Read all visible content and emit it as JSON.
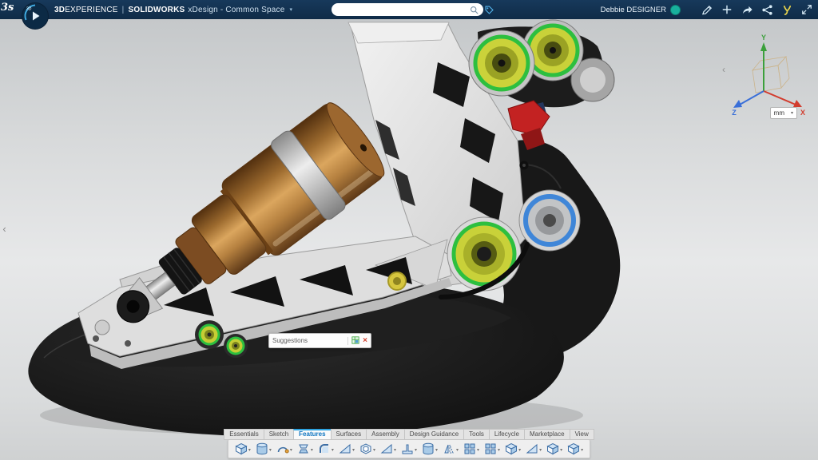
{
  "colors": {
    "topbar": "#12334f",
    "accent": "#2ea3e0",
    "active_tab_text": "#0d74c0",
    "selection_green": "#2dbf3f",
    "shock_bronze": "#b5803f",
    "bearing_blue": "#3f86d8"
  },
  "logo": {
    "monogram": "3s",
    "compass_label": "3D"
  },
  "app": {
    "brand_bold": "3D",
    "brand_rest": "EXPERIENCE",
    "separator": "|",
    "product": "SOLIDWORKS",
    "workspace": "xDesign - Common Space",
    "workspace_caret": "▾"
  },
  "topbar": {
    "search": {
      "placeholder": "",
      "value": ""
    },
    "user": {
      "name": "Debbie DESIGNER"
    },
    "icons": [
      {
        "name": "pen-message-icon",
        "glyph": "pen"
      },
      {
        "name": "add-icon",
        "glyph": "plus"
      },
      {
        "name": "share-arrow-icon",
        "glyph": "forward"
      },
      {
        "name": "share-network-icon",
        "glyph": "nodes"
      },
      {
        "name": "swym-community-icon",
        "glyph": "swym"
      },
      {
        "name": "fullscreen-icon",
        "glyph": "expand"
      }
    ]
  },
  "viewport": {
    "panel_collapse": "‹",
    "triad": {
      "x_label": "X",
      "y_label": "Y",
      "z_label": "Z",
      "rotate_left": "‹"
    },
    "units": {
      "value": "mm",
      "caret": "▾"
    },
    "suggestions": {
      "label": "Suggestions",
      "close": "×"
    }
  },
  "ribbon": {
    "tabs": [
      {
        "label": "Essentials",
        "active": false
      },
      {
        "label": "Sketch",
        "active": false
      },
      {
        "label": "Features",
        "active": true
      },
      {
        "label": "Surfaces",
        "active": false
      },
      {
        "label": "Assembly",
        "active": false
      },
      {
        "label": "Design Guidance",
        "active": false
      },
      {
        "label": "Tools",
        "active": false
      },
      {
        "label": "Lifecycle",
        "active": false
      },
      {
        "label": "Marketplace",
        "active": false
      },
      {
        "label": "View",
        "active": false
      }
    ],
    "tools": [
      {
        "name": "extrude",
        "glyph": "cube"
      },
      {
        "name": "revolve",
        "glyph": "cylinder"
      },
      {
        "name": "sweep",
        "glyph": "swirl"
      },
      {
        "name": "loft",
        "glyph": "loft"
      },
      {
        "name": "fillet",
        "glyph": "round"
      },
      {
        "name": "chamfer",
        "glyph": "wedge"
      },
      {
        "name": "shell",
        "glyph": "shell"
      },
      {
        "name": "draft",
        "glyph": "wedge"
      },
      {
        "name": "rib",
        "glyph": "rib"
      },
      {
        "name": "hole",
        "glyph": "cylinder"
      },
      {
        "name": "mirror",
        "glyph": "mirror"
      },
      {
        "name": "linear-pattern",
        "glyph": "grid"
      },
      {
        "name": "circular-pattern",
        "glyph": "grid"
      },
      {
        "name": "combine",
        "glyph": "cube"
      },
      {
        "name": "split",
        "glyph": "wedge"
      },
      {
        "name": "move-face",
        "glyph": "cube"
      },
      {
        "name": "delete-face",
        "glyph": "cube"
      }
    ]
  }
}
